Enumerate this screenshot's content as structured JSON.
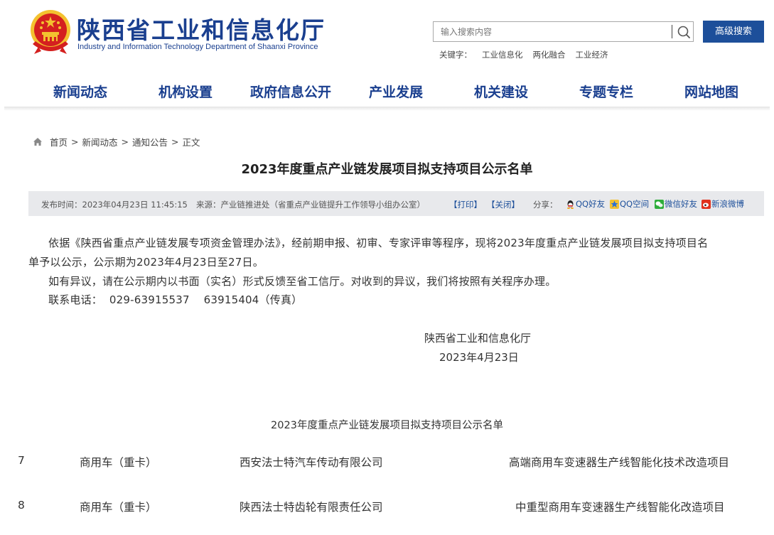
{
  "header": {
    "title": "陕西省工业和信息化厅",
    "subtitle": "Industry and Information Technology Department of Shaanxi Province",
    "emblem_icon": "national-emblem-icon",
    "search_placeholder": "输入搜索内容",
    "search_icon": "search-icon",
    "advanced_search_label": "高级搜索",
    "keywords_label": "关键字：",
    "keywords": [
      "工业信息化",
      "两化融合",
      "工业经济"
    ]
  },
  "nav": {
    "items": [
      "新闻动态",
      "机构设置",
      "政府信息公开",
      "产业发展",
      "机关建设",
      "专题专栏",
      "网站地图"
    ]
  },
  "breadcrumb": {
    "items": [
      "首页",
      "新闻动态",
      "通知公告",
      "正文"
    ],
    "separator": ">"
  },
  "article": {
    "title": "2023年度重点产业链发展项目拟支持项目公示名单",
    "publish_label": "发布时间：",
    "publish_time": "2023年04月23日 11:45:15",
    "source_label": "来源：",
    "source": "产业链推进处（省重点产业链提升工作领导小组办公室）",
    "print_label": "【打印】",
    "close_label": "【关闭】",
    "share_label": "分享：",
    "share": [
      "QQ好友",
      "QQ空间",
      "微信好友",
      "新浪微博"
    ],
    "paragraphs": [
      "依据《陕西省重点产业链发展专项资金管理办法》，经前期申报、初审、专家评审等程序，现将2023年度重点产业链发展项目拟支持项目名",
      "单予以公示，公示期为2023年4月23日至27日。",
      "如有异议，请在公示期内以书面（实名）形式反馈至省工信厅。对收到的异议，我们将按照有关程序办理。",
      "联系电话：  029-63915537    63915404（传真）"
    ],
    "signature_org": "陕西省工业和信息化厅",
    "signature_date": "2023年4月23日",
    "table_title": "2023年度重点产业链发展项目拟支持项目公示名单",
    "rows": [
      {
        "no": "7",
        "category": "商用车（重卡）",
        "company": "西安法士特汽车传动有限公司",
        "project": "高端商用车变速器生产线智能化技术改造项目"
      },
      {
        "no": "8",
        "category": "商用车（重卡）",
        "company": "陕西法士特齿轮有限责任公司",
        "project": "中重型商用车变速器生产线智能化改造项目"
      }
    ]
  },
  "colors": {
    "brand_blue": "#1a3f8f",
    "button_blue": "#1d4f9a",
    "emblem_red": "#d4201f",
    "emblem_gold": "#f3c12f",
    "infobar_bg": "#e8e9ec"
  }
}
